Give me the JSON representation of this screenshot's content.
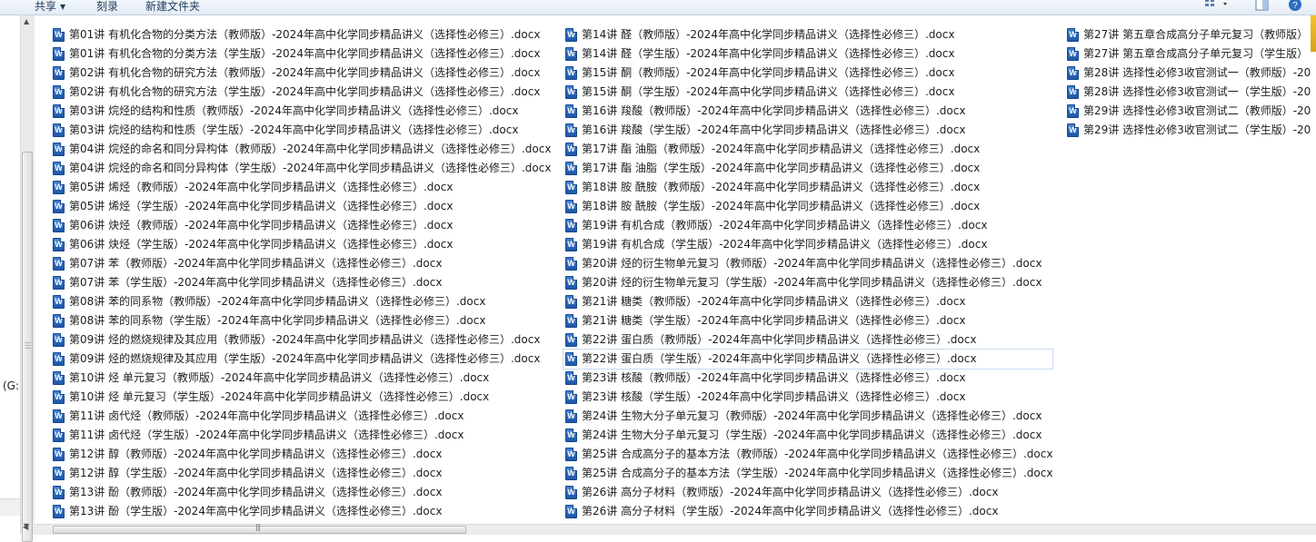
{
  "toolbar": {
    "share_label": "共享",
    "burn_label": "刻录",
    "new_folder_label": "新建文件夹"
  },
  "nav": {
    "drive_label": "(G:"
  },
  "columns": [
    [
      "第01讲 有机化合物的分类方法（教师版）-2024年高中化学同步精品讲义（选择性必修三）.docx",
      "第01讲 有机化合物的分类方法（学生版）-2024年高中化学同步精品讲义（选择性必修三）.docx",
      "第02讲 有机化合物的研究方法（教师版）-2024年高中化学同步精品讲义（选择性必修三）.docx",
      "第02讲 有机化合物的研究方法（学生版）-2024年高中化学同步精品讲义（选择性必修三）.docx",
      "第03讲 烷烃的结构和性质（教师版）-2024年高中化学同步精品讲义（选择性必修三）.docx",
      "第03讲 烷烃的结构和性质（学生版）-2024年高中化学同步精品讲义（选择性必修三）.docx",
      "第04讲 烷烃的命名和同分异构体（教师版）-2024年高中化学同步精品讲义（选择性必修三）.docx",
      "第04讲 烷烃的命名和同分异构体（学生版）-2024年高中化学同步精品讲义（选择性必修三）.docx",
      "第05讲 烯烃（教师版）-2024年高中化学同步精品讲义（选择性必修三）.docx",
      "第05讲 烯烃（学生版）-2024年高中化学同步精品讲义（选择性必修三）.docx",
      "第06讲 炔烃（教师版）-2024年高中化学同步精品讲义（选择性必修三）.docx",
      "第06讲 炔烃（学生版）-2024年高中化学同步精品讲义（选择性必修三）.docx",
      "第07讲 苯（教师版）-2024年高中化学同步精品讲义（选择性必修三）.docx",
      "第07讲 苯（学生版）-2024年高中化学同步精品讲义（选择性必修三）.docx",
      "第08讲 苯的同系物（教师版）-2024年高中化学同步精品讲义（选择性必修三）.docx",
      "第08讲 苯的同系物（学生版）-2024年高中化学同步精品讲义（选择性必修三）.docx",
      "第09讲 烃的燃烧规律及其应用（教师版）-2024年高中化学同步精品讲义（选择性必修三）.docx",
      "第09讲 烃的燃烧规律及其应用（学生版）-2024年高中化学同步精品讲义（选择性必修三）.docx",
      "第10讲 烃 单元复习（教师版）-2024年高中化学同步精品讲义（选择性必修三）.docx",
      "第10讲 烃 单元复习（学生版）-2024年高中化学同步精品讲义（选择性必修三）.docx",
      "第11讲 卤代烃（教师版）-2024年高中化学同步精品讲义（选择性必修三）.docx",
      "第11讲 卤代烃（学生版）-2024年高中化学同步精品讲义（选择性必修三）.docx",
      "第12讲 醇（教师版）-2024年高中化学同步精品讲义（选择性必修三）.docx",
      "第12讲 醇（学生版）-2024年高中化学同步精品讲义（选择性必修三）.docx",
      "第13讲 酚（教师版）-2024年高中化学同步精品讲义（选择性必修三）.docx",
      "第13讲 酚（学生版）-2024年高中化学同步精品讲义（选择性必修三）.docx"
    ],
    [
      "第14讲 醛（教师版）-2024年高中化学同步精品讲义（选择性必修三）.docx",
      "第14讲 醛（学生版）-2024年高中化学同步精品讲义（选择性必修三）.docx",
      "第15讲 酮（教师版）-2024年高中化学同步精品讲义（选择性必修三）.docx",
      "第15讲 酮（学生版）-2024年高中化学同步精品讲义（选择性必修三）.docx",
      "第16讲 羧酸（教师版）-2024年高中化学同步精品讲义（选择性必修三）.docx",
      "第16讲 羧酸（学生版）-2024年高中化学同步精品讲义（选择性必修三）.docx",
      "第17讲 酯 油脂（教师版）-2024年高中化学同步精品讲义（选择性必修三）.docx",
      "第17讲 酯 油脂（学生版）-2024年高中化学同步精品讲义（选择性必修三）.docx",
      "第18讲 胺 酰胺（教师版）-2024年高中化学同步精品讲义（选择性必修三）.docx",
      "第18讲 胺 酰胺（学生版）-2024年高中化学同步精品讲义（选择性必修三）.docx",
      "第19讲 有机合成（教师版）-2024年高中化学同步精品讲义（选择性必修三）.docx",
      "第19讲 有机合成（学生版）-2024年高中化学同步精品讲义（选择性必修三）.docx",
      "第20讲 烃的衍生物单元复习（教师版）-2024年高中化学同步精品讲义（选择性必修三）.docx",
      "第20讲 烃的衍生物单元复习（学生版）-2024年高中化学同步精品讲义（选择性必修三）.docx",
      "第21讲 糖类（教师版）-2024年高中化学同步精品讲义（选择性必修三）.docx",
      "第21讲 糖类（学生版）-2024年高中化学同步精品讲义（选择性必修三）.docx",
      "第22讲 蛋白质（教师版）-2024年高中化学同步精品讲义（选择性必修三）.docx",
      "第22讲 蛋白质（学生版）-2024年高中化学同步精品讲义（选择性必修三）.docx",
      "第23讲 核酸（教师版）-2024年高中化学同步精品讲义（选择性必修三）.docx",
      "第23讲 核酸（学生版）-2024年高中化学同步精品讲义（选择性必修三）.docx",
      "第24讲 生物大分子单元复习（教师版）-2024年高中化学同步精品讲义（选择性必修三）.docx",
      "第24讲 生物大分子单元复习（学生版）-2024年高中化学同步精品讲义（选择性必修三）.docx",
      "第25讲 合成高分子的基本方法（教师版）-2024年高中化学同步精品讲义（选择性必修三）.docx",
      "第25讲 合成高分子的基本方法（学生版）-2024年高中化学同步精品讲义（选择性必修三）.docx",
      "第26讲 高分子材料（教师版）-2024年高中化学同步精品讲义（选择性必修三）.docx",
      "第26讲 高分子材料（学生版）-2024年高中化学同步精品讲义（选择性必修三）.docx"
    ],
    [
      "第27讲 第五章合成高分子单元复习（教师版）",
      "第27讲 第五章合成高分子单元复习（学生版）",
      "第28讲 选择性必修3收官测试一（教师版）-20",
      "第28讲 选择性必修3收官测试一（学生版）-20",
      "第29讲 选择性必修3收官测试二（教师版）-20",
      "第29讲 选择性必修3收官测试二（学生版）-20"
    ]
  ],
  "selected": {
    "column": 1,
    "row": 17
  },
  "colors": {
    "toolbar_text": "#1e3b5c",
    "word_icon": "#2b63b8",
    "selection_border": "#c7d8ee"
  },
  "icons": {
    "file": "word-document-icon"
  }
}
